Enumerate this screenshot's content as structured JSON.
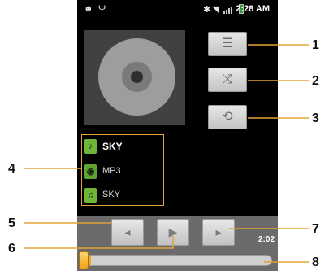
{
  "status_bar": {
    "time": "2:28 AM",
    "icons": [
      "android-icon",
      "usb-icon",
      "bluetooth-icon",
      "wifi-icon",
      "signal-icon",
      "battery-icon"
    ]
  },
  "side_buttons": [
    {
      "name": "playlist-button",
      "icon": "list-icon",
      "glyph": "☰"
    },
    {
      "name": "shuffle-button",
      "icon": "shuffle-icon",
      "glyph": "⤨"
    },
    {
      "name": "repeat-button",
      "icon": "repeat-icon",
      "glyph": "⟲"
    }
  ],
  "track_info": {
    "title": "SKY",
    "album": "MP3",
    "artist": "SKY"
  },
  "controls": {
    "prev_glyph": "◂",
    "play_glyph": "▶",
    "next_glyph": "▸",
    "elapsed": "2:02"
  },
  "progress": {
    "fraction": 0.05
  },
  "callouts": [
    "1",
    "2",
    "3",
    "4",
    "5",
    "6",
    "7",
    "8"
  ],
  "colors": {
    "accent": "#e3a33a",
    "icon_green": "#6fb637",
    "thumb": "#f1a017"
  }
}
